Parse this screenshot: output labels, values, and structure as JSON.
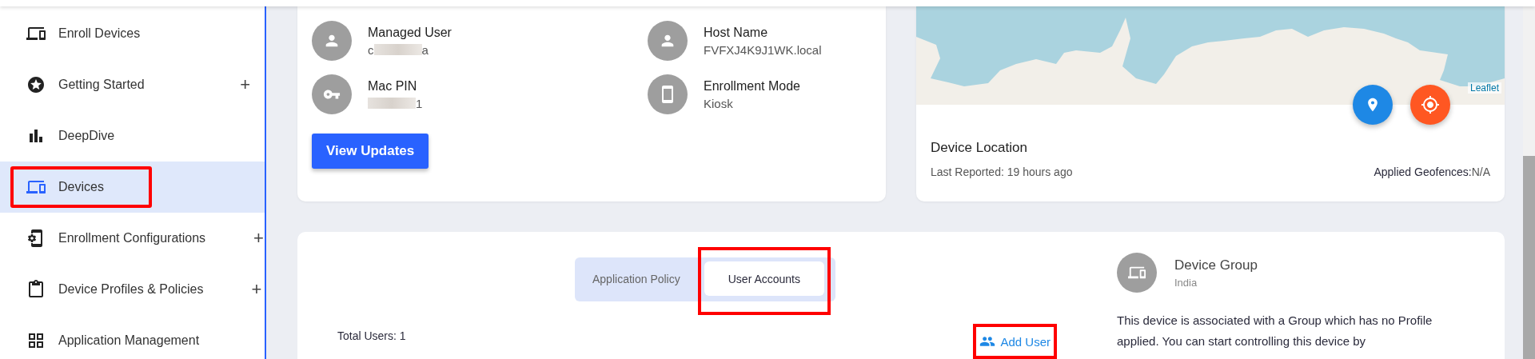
{
  "sidebar": {
    "items": [
      {
        "label": "Enroll Devices",
        "kind": "enroll",
        "selected": false,
        "highlighted": false
      },
      {
        "label": "Getting Started",
        "kind": "star",
        "expander": "+",
        "selected": false,
        "highlighted": false
      },
      {
        "label": "DeepDive",
        "kind": "chart",
        "selected": false,
        "highlighted": false
      },
      {
        "label": "Devices",
        "kind": "devices",
        "selected": true,
        "highlighted": true
      },
      {
        "label": "Enrollment Configurations",
        "kind": "config",
        "expander": "+",
        "selected": false,
        "highlighted": false
      },
      {
        "label": "Device Profiles & Policies",
        "kind": "clipboard",
        "expander": "+",
        "selected": false,
        "highlighted": false
      },
      {
        "label": "Application Management",
        "kind": "grid",
        "selected": false,
        "highlighted": false
      }
    ]
  },
  "device_info": {
    "fields": [
      {
        "label": "Managed User",
        "kind": "user",
        "value_before": "c",
        "value_after": "a",
        "redacted": true
      },
      {
        "label": "Host Name",
        "kind": "user",
        "value_before": "FVFXJ4K9J1WK.local",
        "redacted": false
      },
      {
        "label": "Mac PIN",
        "kind": "key",
        "value_after": "1",
        "redacted": true
      },
      {
        "label": "Enrollment Mode",
        "kind": "phone",
        "value_before": "Kiosk",
        "redacted": false
      }
    ],
    "button": "View Updates"
  },
  "location": {
    "map_buttons": [
      {
        "kind": "pin",
        "color": "#1e88e5"
      },
      {
        "kind": "target",
        "color": "#ff5722"
      }
    ],
    "attribution": "Leaflet",
    "title": "Device Location",
    "last_reported": "Last Reported: 19 hours ago",
    "geofence_label": "Applied Geofences:",
    "geofence_value": "N/A"
  },
  "policy": {
    "tabs": [
      {
        "label": "Application Policy",
        "selected": false,
        "highlighted": false
      },
      {
        "label": "User Accounts",
        "selected": true,
        "highlighted": true
      }
    ],
    "total_users": "Total Users: 1",
    "add_user": {
      "label": "Add User",
      "highlighted": true
    }
  },
  "device_group": {
    "title": "Device Group",
    "subtitle": "India",
    "description": "This device is associated with a Group which has no Profile applied. You can start controlling this device by"
  }
}
